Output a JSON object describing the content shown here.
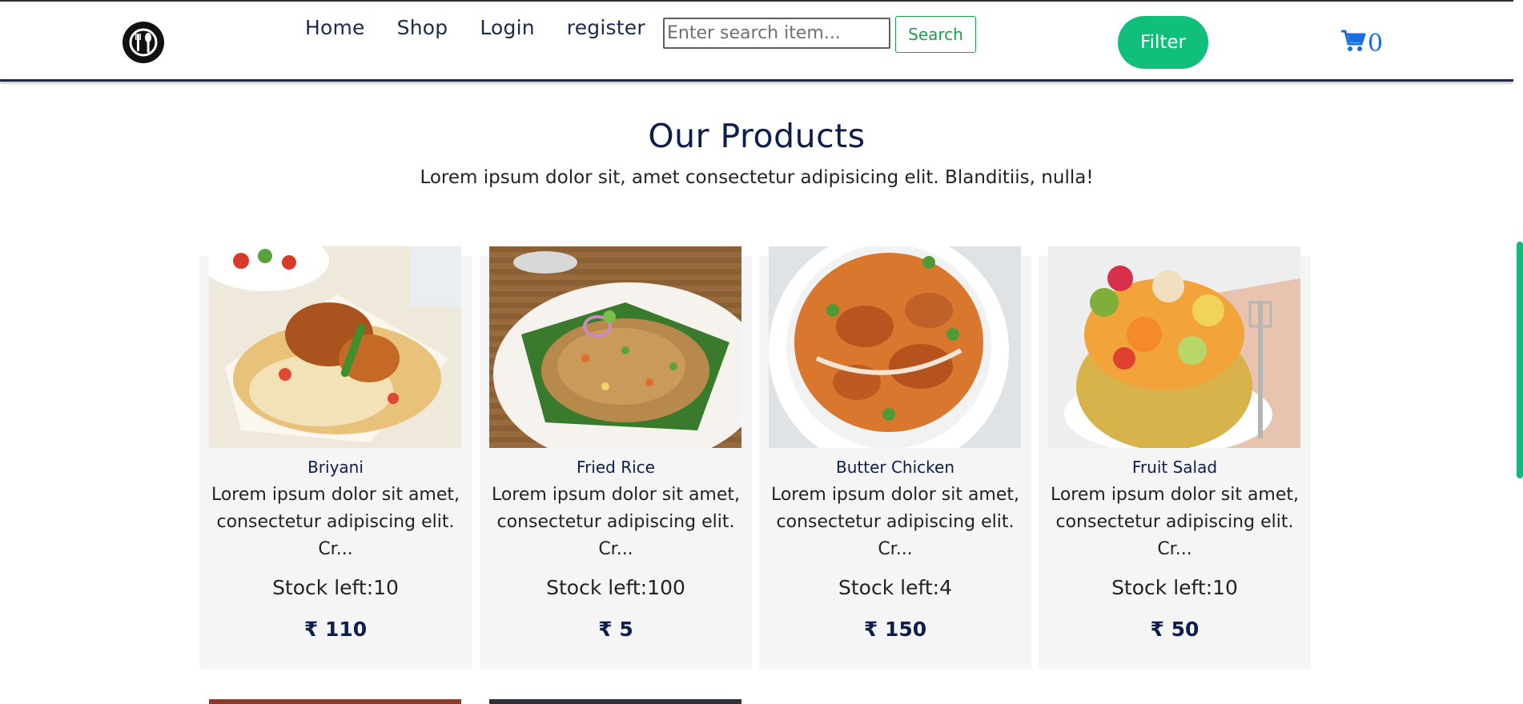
{
  "header": {
    "nav": [
      "Home",
      "Shop",
      "Login",
      "register"
    ],
    "search": {
      "placeholder": "Enter search item...",
      "value": ""
    },
    "search_button": "Search",
    "filter_button": "Filter",
    "cart_count": "0",
    "logo_icon": "restaurant-logo-icon"
  },
  "section": {
    "title": "Our Products",
    "subtitle": "Lorem ipsum dolor sit, amet consectetur adipisicing elit. Blanditiis, nulla!"
  },
  "products": [
    {
      "name": "Briyani",
      "desc": "Lorem ipsum dolor sit amet, consectetur adipiscing elit. Cr...",
      "stock": "Stock left:10",
      "price": "₹ 110"
    },
    {
      "name": "Fried Rice",
      "desc": "Lorem ipsum dolor sit amet, consectetur adipiscing elit. Cr...",
      "stock": "Stock left:100",
      "price": "₹ 5"
    },
    {
      "name": "Butter Chicken",
      "desc": "Lorem ipsum dolor sit amet, consectetur adipiscing elit. Cr...",
      "stock": "Stock left:4",
      "price": "₹ 150"
    },
    {
      "name": "Fruit Salad",
      "desc": "Lorem ipsum dolor sit amet, consectetur adipiscing elit. Cr...",
      "stock": "Stock left:10",
      "price": "₹ 50"
    }
  ],
  "colors": {
    "accent_green": "#0fbf7b",
    "navy": "#0d1e4d",
    "cart_blue": "#1a6fe0",
    "card_bg": "#f5f5f5"
  }
}
